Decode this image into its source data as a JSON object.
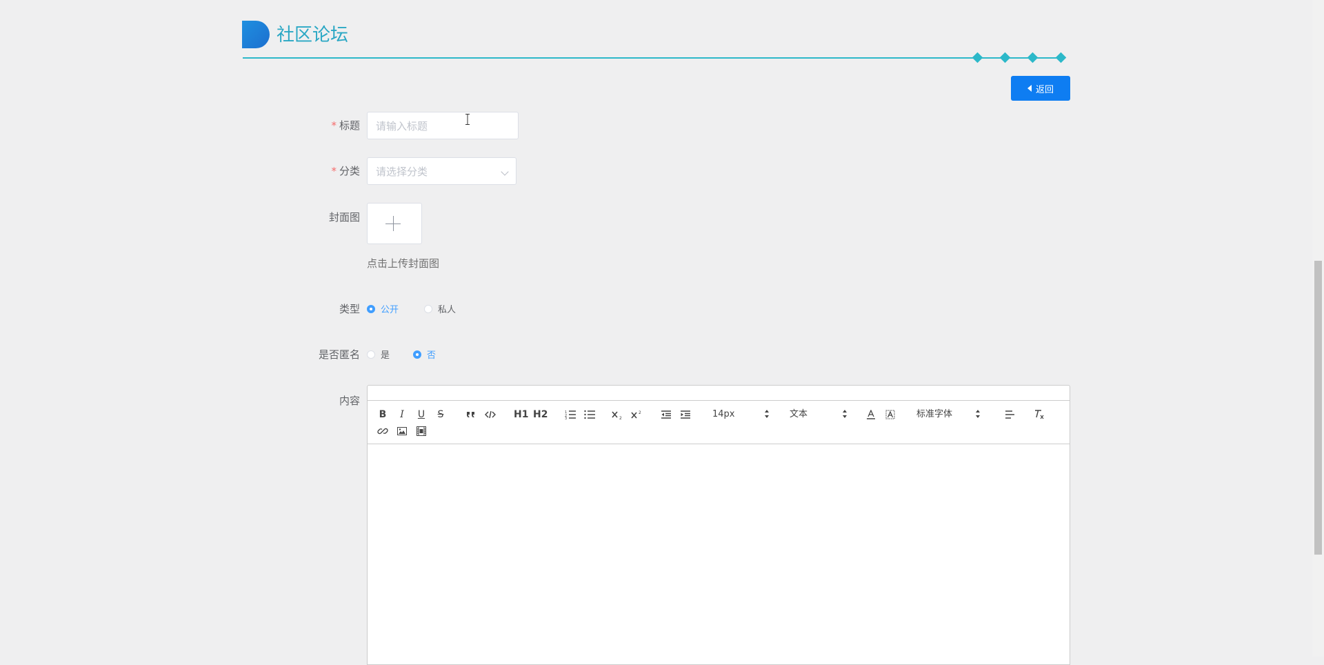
{
  "header": {
    "title": "社区论坛"
  },
  "back_button": {
    "label": "返回"
  },
  "form": {
    "title": {
      "label": "标题",
      "placeholder": "请输入标题"
    },
    "category": {
      "label": "分类",
      "placeholder": "请选择分类"
    },
    "cover": {
      "label": "封面图",
      "hint": "点击上传封面图"
    },
    "type": {
      "label": "类型",
      "options": [
        "公开",
        "私人"
      ],
      "selected": "公开"
    },
    "anonymous": {
      "label": "是否匿名",
      "options": [
        "是",
        "否"
      ],
      "selected": "否"
    },
    "content": {
      "label": "内容"
    }
  },
  "editor": {
    "toolbar": {
      "bold": "B",
      "italic": "I",
      "underline": "U",
      "strike": "S",
      "h1": "H1",
      "h2": "H2",
      "size": "14px",
      "header_select": "文本",
      "font_select": "标准字体"
    },
    "icons": [
      "bold-icon",
      "italic-icon",
      "underline-icon",
      "strike-icon",
      "blockquote-icon",
      "code-block-icon",
      "h1-icon",
      "h2-icon",
      "ordered-list-icon",
      "bullet-list-icon",
      "subscript-icon",
      "superscript-icon",
      "outdent-icon",
      "indent-icon",
      "font-color-icon",
      "background-color-icon",
      "align-icon",
      "clean-icon",
      "link-icon",
      "image-icon",
      "video-icon"
    ]
  },
  "colors": {
    "accent": "#2cb8c9",
    "primary_button": "#0e7df2",
    "radio_checked": "#409eff",
    "required": "#f56c6c"
  }
}
